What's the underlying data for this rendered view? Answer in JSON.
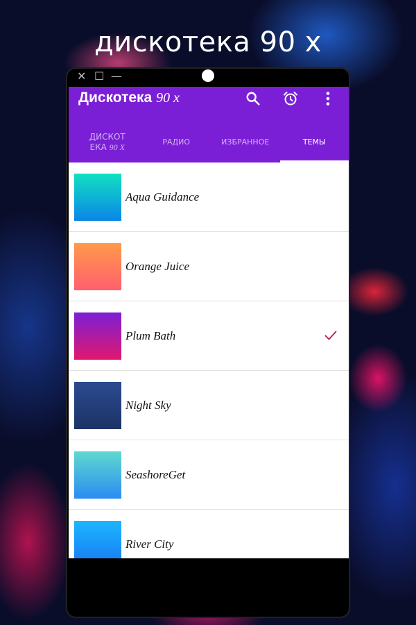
{
  "headline": "дискотека 90 х",
  "window_controls": {
    "close": "✕",
    "maximize": "☐",
    "minimize": "—"
  },
  "app": {
    "title_main": "Дискотека",
    "title_italic": "90 х",
    "accent": "#7b1fd6"
  },
  "actions": [
    {
      "icon": "search-icon"
    },
    {
      "icon": "alarm-clock-icon"
    },
    {
      "icon": "more-vert-icon"
    }
  ],
  "tabs": [
    {
      "line1": "ДИСКОТ",
      "line2": "ЕКА",
      "italic": "90 Х"
    },
    {
      "label": "РАДИО"
    },
    {
      "label": "ИЗБРАННОЕ"
    },
    {
      "label": "ТЕМЫ",
      "active": true
    }
  ],
  "themes": [
    {
      "name": "Aqua Guidance",
      "from": "#12e0c0",
      "to": "#0a86e8"
    },
    {
      "name": "Orange Juice",
      "from": "#ff9a4a",
      "to": "#ff5f6d"
    },
    {
      "name": "Plum Bath",
      "from": "#7b1fd6",
      "to": "#e0186e",
      "selected": true
    },
    {
      "name": "Night Sky",
      "from": "#2b4a8f",
      "to": "#1c3366"
    },
    {
      "name": "SeashoreGet",
      "from": "#5fd9cf",
      "to": "#2b8cf2"
    },
    {
      "name": "River City",
      "from": "#1cb6ff",
      "to": "#1976f2"
    }
  ],
  "check_color": "#c2185b"
}
